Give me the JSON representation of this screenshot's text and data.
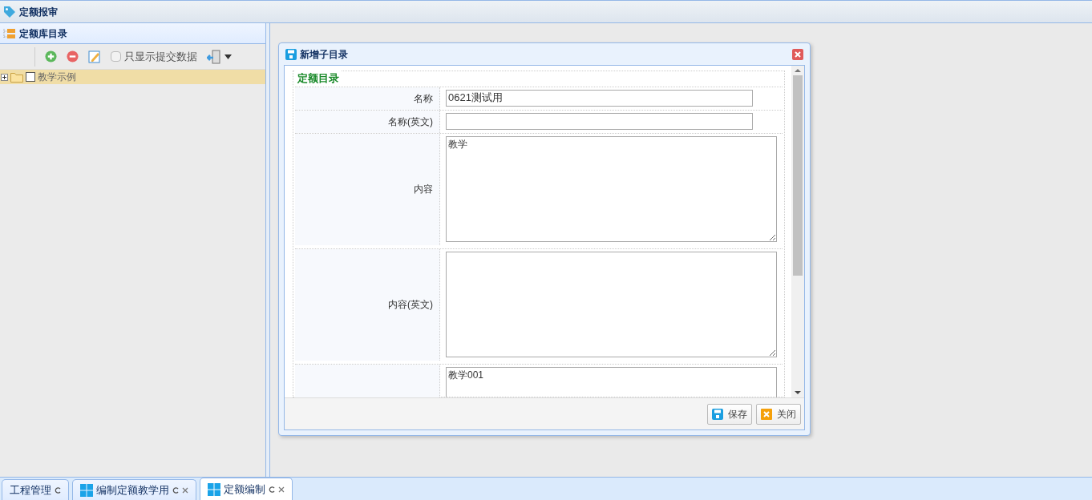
{
  "header": {
    "title": "定额报审"
  },
  "left_panel": {
    "title": "定额库目录",
    "toolbar": {
      "filter": {
        "label": "只显示提交数据",
        "checked": false
      }
    },
    "tree": [
      {
        "label": "教学示例",
        "expanded": false,
        "checked": false,
        "selected": true
      }
    ]
  },
  "dialog": {
    "title": "新增子目录",
    "legend": "定额目录",
    "fields": [
      {
        "kind": "input",
        "label": "名称",
        "value": "0621测试用"
      },
      {
        "kind": "input",
        "label": "名称(英文)"
      },
      {
        "kind": "textarea",
        "label": "内容",
        "value": "教学"
      },
      {
        "kind": "textarea",
        "label": "内容(英文)"
      },
      {
        "kind": "textarea",
        "value": "教学001"
      }
    ],
    "buttons": [
      {
        "kind": "save",
        "label": "保存"
      },
      {
        "kind": "close",
        "label": "关闭"
      }
    ]
  },
  "tabs": [
    {
      "label": "工程管理",
      "selected": false,
      "icon": false,
      "closable": false
    },
    {
      "label": "编制定额教学用",
      "selected": false,
      "icon": true,
      "closable": true
    },
    {
      "label": "定额编制",
      "selected": true,
      "icon": true,
      "closable": true
    }
  ]
}
